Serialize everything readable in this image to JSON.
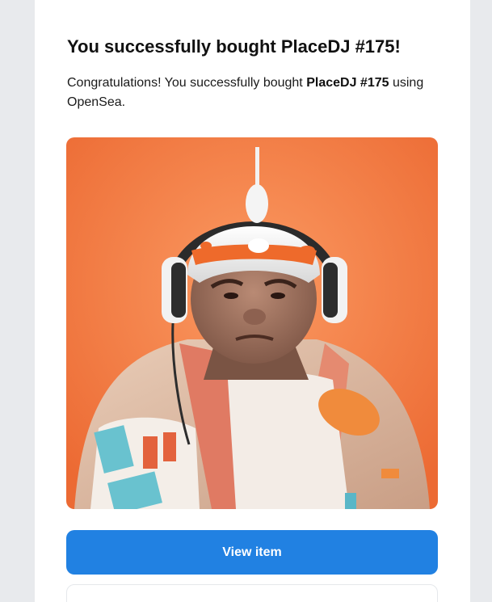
{
  "email": {
    "title": "You successfully bought PlaceDJ #175!",
    "message_prefix": "Congratulations! You successfully bought ",
    "item_name": "PlaceDJ #175",
    "message_suffix": " using OpenSea.",
    "view_button_label": "View item"
  },
  "colors": {
    "page_background": "#e8eaed",
    "card_background": "#ffffff",
    "button_blue": "#2181e2",
    "nft_background": "#f47a40"
  },
  "image": {
    "subject": "nft-character-headphones-helmet-illustration"
  }
}
